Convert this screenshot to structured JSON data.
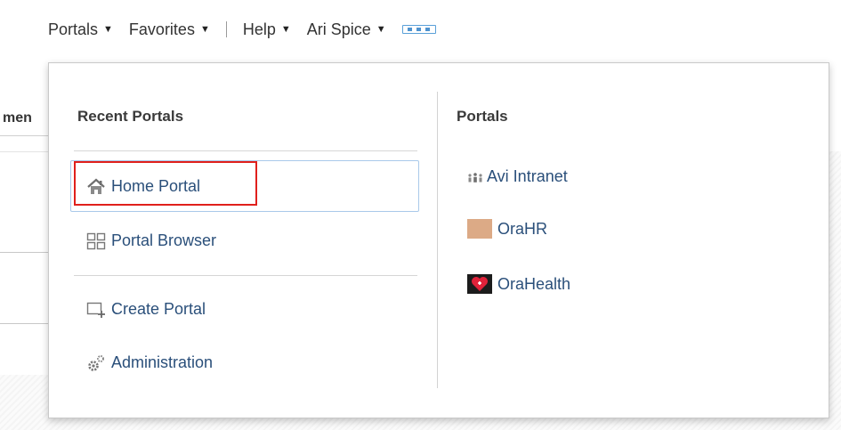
{
  "topnav": {
    "items": [
      {
        "label": "Portals",
        "icon": "caret-down-icon"
      },
      {
        "label": "Favorites",
        "icon": "caret-down-icon"
      },
      {
        "label": "Help",
        "icon": "caret-down-icon"
      },
      {
        "label": "Ari Spice",
        "icon": "caret-down-icon"
      }
    ],
    "more_icon": "more-dots-icon"
  },
  "background": {
    "tab_label": "men"
  },
  "menu": {
    "recent": {
      "heading": "Recent Portals",
      "items": [
        {
          "label": "Home Portal",
          "icon": "home-icon",
          "highlighted": true
        },
        {
          "label": "Portal Browser",
          "icon": "grid-icon"
        }
      ],
      "actions": [
        {
          "label": "Create Portal",
          "icon": "create-portal-icon"
        },
        {
          "label": "Administration",
          "icon": "gears-icon"
        }
      ]
    },
    "portals": {
      "heading": "Portals",
      "items": [
        {
          "label": "Avi Intranet",
          "icon": "people-icon"
        },
        {
          "label": "OraHR",
          "icon": "swatch-icon",
          "color": "#dcaa86"
        },
        {
          "label": "OraHealth",
          "icon": "heart-icon",
          "color": "#e0223a"
        }
      ]
    }
  },
  "colors": {
    "link": "#2a4f7a",
    "highlight_border": "#e0201c",
    "accent": "#4f93cf"
  }
}
